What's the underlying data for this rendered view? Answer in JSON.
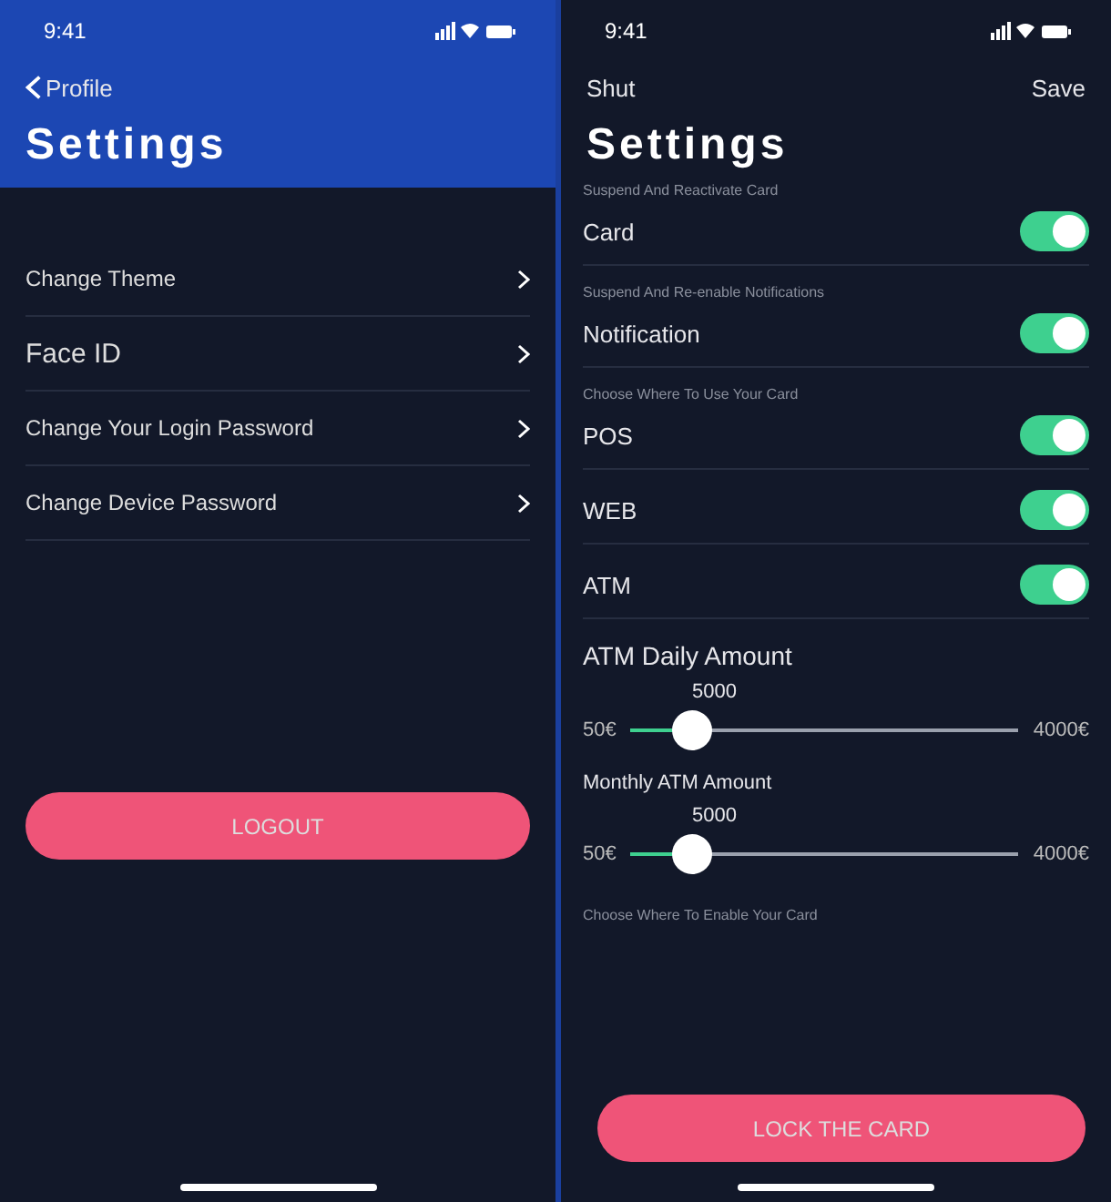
{
  "left_screen": {
    "status_bar": {
      "time": "9:41"
    },
    "back_link": "Profile",
    "title": "Settings",
    "menu_items": [
      {
        "label": "Change Theme"
      },
      {
        "label": "Face ID"
      },
      {
        "label": "Change Your Login Password"
      },
      {
        "label": "Change Device Password"
      }
    ],
    "logout_button": "LOGOUT"
  },
  "right_screen": {
    "status_bar": {
      "time": "9:41"
    },
    "close_link": "Shut",
    "save_link": "Save",
    "title": "Settings",
    "toggles": [
      {
        "section": "Suspend And Reactivate Card",
        "label": "Card",
        "on": true
      },
      {
        "section": "Suspend And Re-enable Notifications",
        "label": "Notification",
        "on": true
      },
      {
        "section": "Choose Where To Use Your Card",
        "label": "POS",
        "on": true
      },
      {
        "label": "WEB",
        "on": true
      },
      {
        "label": "ATM",
        "on": true
      }
    ],
    "sliders": [
      {
        "title": "ATM Daily Amount",
        "value": "5000",
        "min": "50€",
        "max": "4000€",
        "level": 0.16
      },
      {
        "title": "Monthly ATM Amount",
        "value": "5000",
        "min": "50€",
        "max": "4000€",
        "level": 0.16
      }
    ],
    "footer_section": "Choose Where To Enable Your Card",
    "lock_button": "LOCK THE CARD"
  }
}
